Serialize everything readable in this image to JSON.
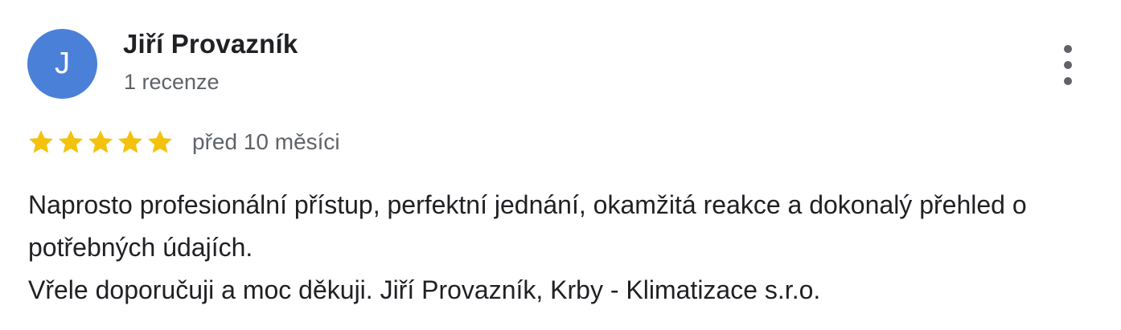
{
  "reviewer": {
    "avatar_initial": "J",
    "avatar_color": "#4a80d8",
    "name": "Jiří Provazník",
    "review_count": "1 recenze"
  },
  "menu": {
    "icon": "more-vert-icon"
  },
  "rating": {
    "stars": 5,
    "max_stars": 5,
    "star_color": "#f4c20d",
    "date": "před 10 měsíci"
  },
  "review": {
    "text_line_1": "Naprosto profesionální přístup, perfektní jednání, okamžitá reakce a dokonalý přehled o potřebných údajích.",
    "text_line_2": "Vřele doporučuji a moc děkuji. Jiří Provazník, Krby - Klimatizace s.r.o."
  }
}
